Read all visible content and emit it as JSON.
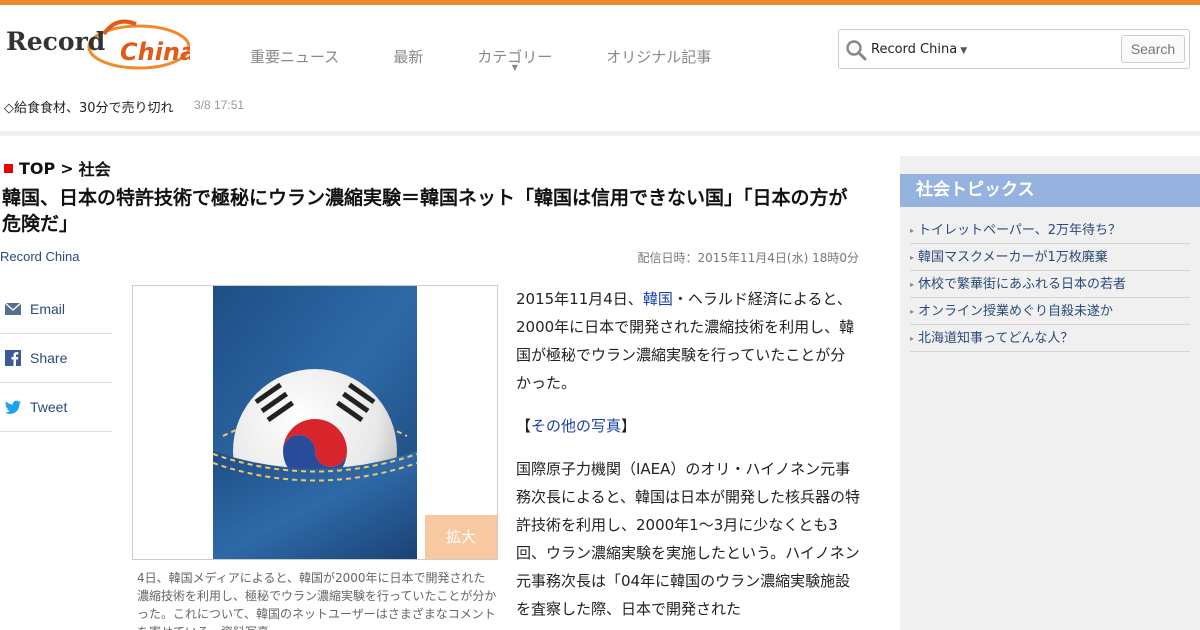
{
  "header": {
    "logo_text": "Record China",
    "nav": [
      {
        "label": "重要ニュース",
        "dropdown": false
      },
      {
        "label": "最新",
        "dropdown": false
      },
      {
        "label": "カテゴリー",
        "dropdown": true
      },
      {
        "label": "オリジナル記事",
        "dropdown": false
      }
    ],
    "search": {
      "scope": "Record China",
      "button": "Search"
    }
  },
  "ticker": {
    "text": "◇給食食材、30分で売り切れ",
    "time": "3/8 17:51"
  },
  "breadcrumb": {
    "top": "TOP",
    "sep": ">",
    "current": "社会"
  },
  "article": {
    "title": "韓国、日本の特許技術で極秘にウラン濃縮実験＝韓国ネット「韓国は信用できない国」「日本の方が危険だ」",
    "source": "Record China",
    "pubdate": "配信日時：2015年11月4日(水) 18時0分",
    "p1_before": "2015年11月4日、",
    "p1_link": "韓国",
    "p1_after": "・ヘラルド経済によると、2000年に日本で開発された濃縮技術を利用し、韓国が極秘でウラン濃縮実験を行っていたことが分かった。",
    "p2_open": "【",
    "p2_link": "その他の写真",
    "p2_close": "】",
    "p3": "国際原子力機関（IAEA）のオリ・ハイノネン元事務次長によると、韓国は日本が開発した核兵器の特許技術を利用し、2000年1〜3月に少なくとも3回、ウラン濃縮実験を実施したという。ハイノネン元事務次長は「04年に韓国のウラン濃縮実験施設を査察した際、日本で開発された"
  },
  "photo": {
    "enlarge": "拡大",
    "caption": "4日、韓国メディアによると、韓国が2000年に日本で開発された濃縮技術を利用し、極秘でウラン濃縮実験を行っていたことが分かった。これについて、韓国のネットユーザーはさまざまなコメントを寄せている。資料写真。"
  },
  "share": [
    {
      "label": "Email",
      "icon": "email-icon"
    },
    {
      "label": "Share",
      "icon": "facebook-icon"
    },
    {
      "label": "Tweet",
      "icon": "twitter-icon"
    }
  ],
  "sidebar": {
    "heading": "社会トピックス",
    "items": [
      "トイレットペーパー、2万年待ち？",
      "韓国マスクメーカーが1万枚廃棄",
      "休校で繁華街にあふれる日本の若者",
      "オンライン授業めぐり自殺未遂か",
      "北海道知事ってどんな人？"
    ]
  },
  "colors": {
    "accent": "#f08a2a",
    "sidebar_head": "#96b3e0",
    "link": "#1a3fa8",
    "enlarge_bg": "#f8c9a0"
  }
}
